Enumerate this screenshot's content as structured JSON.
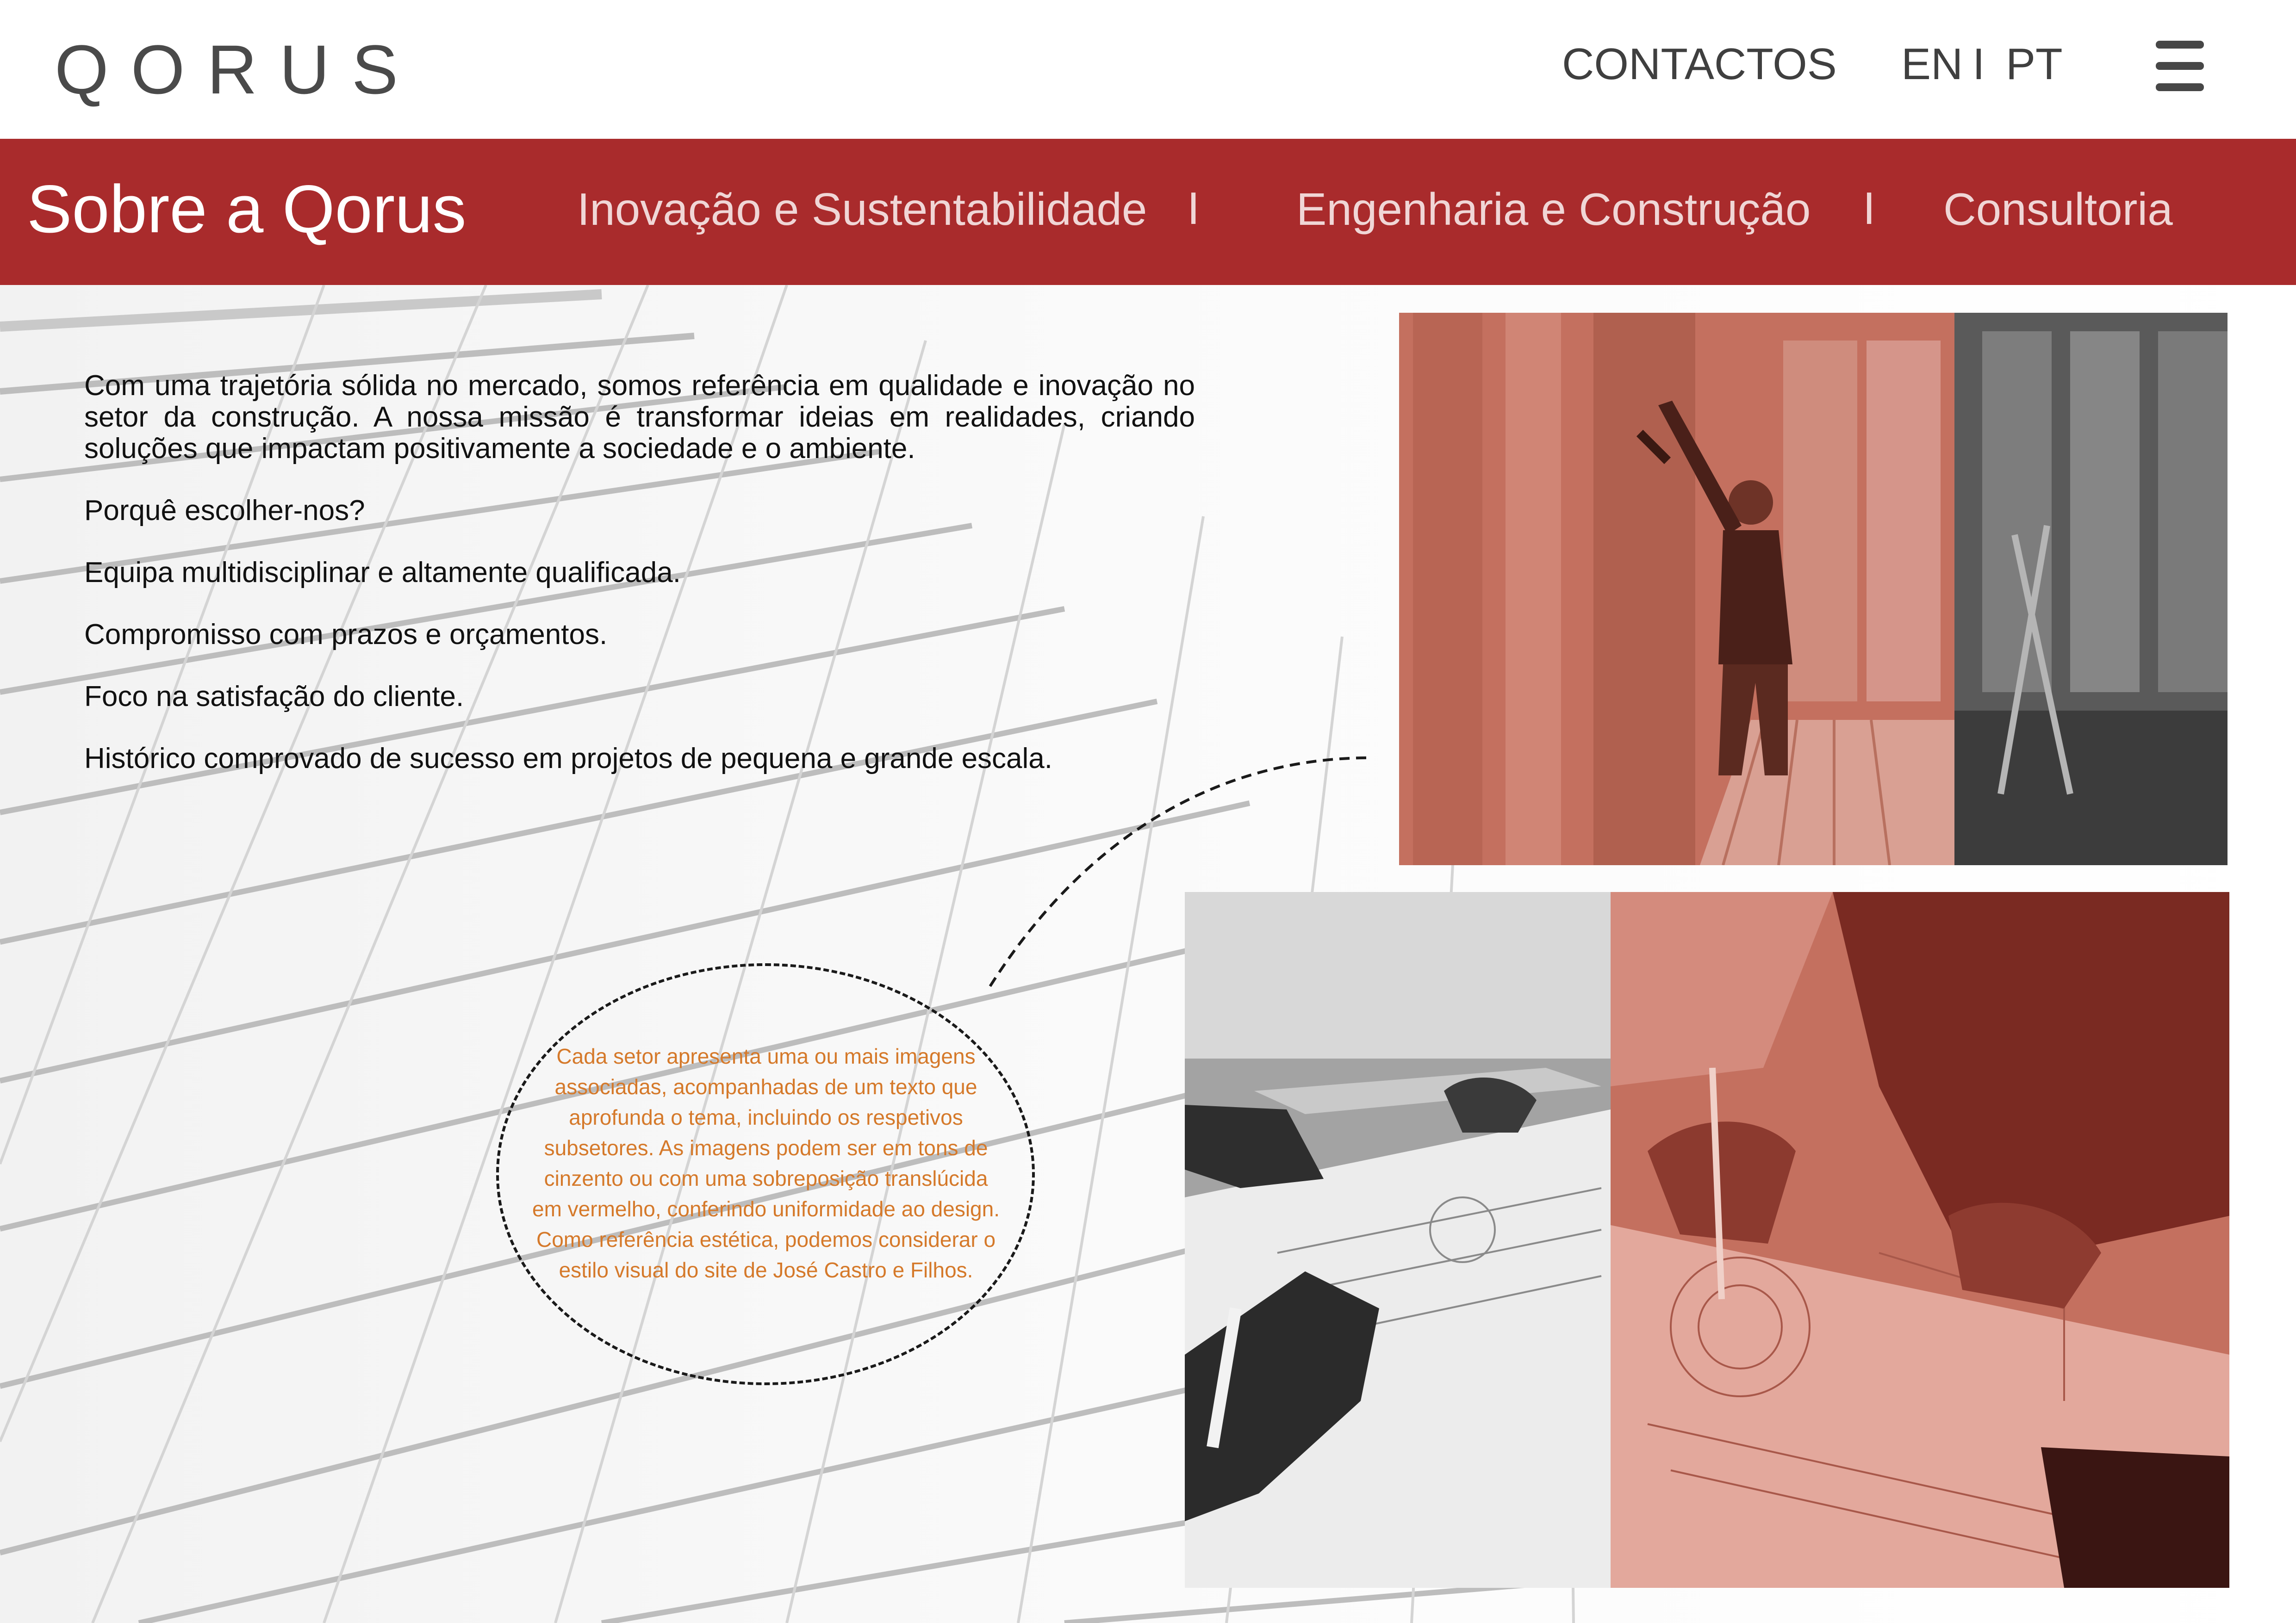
{
  "header": {
    "logo": "QORUS",
    "contact_label": "CONTACTOS",
    "lang_en": "EN",
    "lang_separator": "I",
    "lang_pt": "PT",
    "menu_icon": "hamburger-menu-icon"
  },
  "nav": {
    "title": "Sobre a Qorus",
    "separator": "I",
    "links": [
      "Inovação e Sustentabilidade",
      "Engenharia e Construção",
      "Consultoria"
    ]
  },
  "content": {
    "intro": "Com uma trajetória sólida no mercado, somos referência em qualidade e inovação no setor da construção. A nossa missão é transformar ideias em realidades, criando soluções que impactam positivamente a sociedade e o ambiente.",
    "why_heading": "Porquê escolher-nos?",
    "points": [
      "Equipa multidisciplinar e altamente qualificada.",
      "Compromisso com prazos e orçamentos.",
      "Foco na satisfação do cliente.",
      "Histórico comprovado de sucesso em projetos de pequena e grande escala."
    ]
  },
  "annotation": {
    "text": "Cada setor apresenta uma ou mais imagens associadas, acompanhadas de um texto que aprofunda o tema, incluindo os respetivos subsetores. As imagens podem ser em tons de cinzento ou com uma sobreposição translúcida em vermelho, conferindo uniformidade ao design. Como referência estética, podemos considerar o estilo visual do site de José Castro e Filhos."
  },
  "colors": {
    "brand_red": "#a92b2c",
    "annotation_orange": "#d5792a",
    "photo_red_overlay": "#c4705f"
  }
}
